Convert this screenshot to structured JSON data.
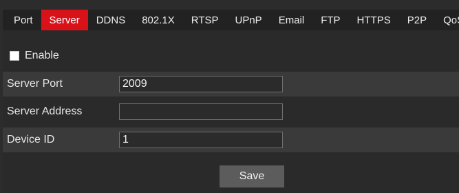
{
  "tabs": [
    {
      "label": "Port",
      "active": false
    },
    {
      "label": "Server",
      "active": true
    },
    {
      "label": "DDNS",
      "active": false
    },
    {
      "label": "802.1X",
      "active": false
    },
    {
      "label": "RTSP",
      "active": false
    },
    {
      "label": "UPnP",
      "active": false
    },
    {
      "label": "Email",
      "active": false
    },
    {
      "label": "FTP",
      "active": false
    },
    {
      "label": "HTTPS",
      "active": false
    },
    {
      "label": "P2P",
      "active": false
    },
    {
      "label": "QoS",
      "active": false
    }
  ],
  "form": {
    "enable_label": "Enable",
    "enable_checked": false,
    "server_port_label": "Server Port",
    "server_port_value": "2009",
    "server_address_label": "Server Address",
    "server_address_value": "",
    "device_id_label": "Device ID",
    "device_id_value": "1",
    "save_label": "Save"
  },
  "colors": {
    "active_tab": "#d9121a",
    "tab_bar": "#222222",
    "background": "#2a2a2a",
    "shaded_row": "#3a3a3a",
    "button": "#5c5c5c"
  }
}
